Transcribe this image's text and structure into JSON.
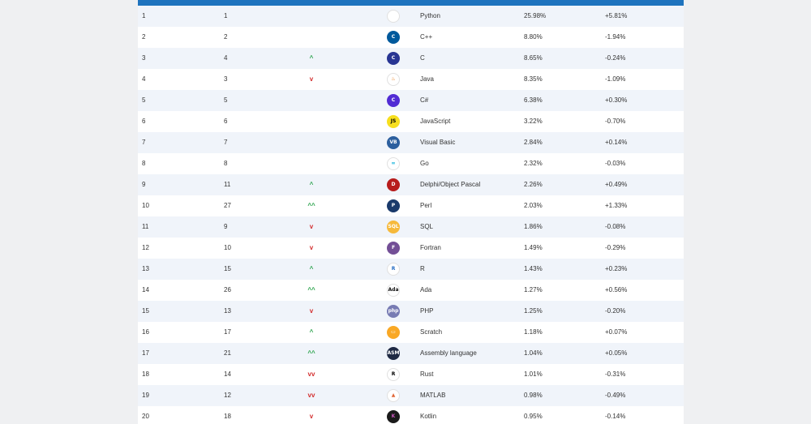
{
  "rows": [
    {
      "rank": "1",
      "prev": "1",
      "change": "",
      "icon": "python-icon",
      "glyph": "",
      "icon_bg": "#ffffff",
      "icon_fg": "#3776ab",
      "lang": "Python",
      "rating": "25.98%",
      "delta": "+5.81%"
    },
    {
      "rank": "2",
      "prev": "2",
      "change": "",
      "icon": "cpp-icon",
      "glyph": "C",
      "icon_bg": "#00599c",
      "icon_fg": "#ffffff",
      "lang": "C++",
      "rating": "8.80%",
      "delta": "-1.94%"
    },
    {
      "rank": "3",
      "prev": "4",
      "change": "up",
      "icon": "c-icon",
      "glyph": "C",
      "icon_bg": "#283593",
      "icon_fg": "#ffffff",
      "lang": "C",
      "rating": "8.65%",
      "delta": "-0.24%"
    },
    {
      "rank": "4",
      "prev": "3",
      "change": "down",
      "icon": "java-icon",
      "glyph": "♨",
      "icon_bg": "#ffffff",
      "icon_fg": "#e76f00",
      "lang": "Java",
      "rating": "8.35%",
      "delta": "-1.09%"
    },
    {
      "rank": "5",
      "prev": "5",
      "change": "",
      "icon": "csharp-icon",
      "glyph": "C",
      "icon_bg": "#512bd4",
      "icon_fg": "#ffffff",
      "lang": "C#",
      "rating": "6.38%",
      "delta": "+0.30%"
    },
    {
      "rank": "6",
      "prev": "6",
      "change": "",
      "icon": "javascript-icon",
      "glyph": "JS",
      "icon_bg": "#f7df1e",
      "icon_fg": "#000000",
      "lang": "JavaScript",
      "rating": "3.22%",
      "delta": "-0.70%"
    },
    {
      "rank": "7",
      "prev": "7",
      "change": "",
      "icon": "visual-basic-icon",
      "glyph": "VB",
      "icon_bg": "#2c5f9e",
      "icon_fg": "#ffffff",
      "lang": "Visual Basic",
      "rating": "2.84%",
      "delta": "+0.14%"
    },
    {
      "rank": "8",
      "prev": "8",
      "change": "",
      "icon": "go-icon",
      "glyph": "∞",
      "icon_bg": "#ffffff",
      "icon_fg": "#00add8",
      "lang": "Go",
      "rating": "2.32%",
      "delta": "-0.03%"
    },
    {
      "rank": "9",
      "prev": "11",
      "change": "up",
      "icon": "delphi-icon",
      "glyph": "D",
      "icon_bg": "#b71c1c",
      "icon_fg": "#ffffff",
      "lang": "Delphi/Object Pascal",
      "rating": "2.26%",
      "delta": "+0.49%"
    },
    {
      "rank": "10",
      "prev": "27",
      "change": "up2",
      "icon": "perl-icon",
      "glyph": "P",
      "icon_bg": "#1a3a6b",
      "icon_fg": "#ffffff",
      "lang": "Perl",
      "rating": "2.03%",
      "delta": "+1.33%"
    },
    {
      "rank": "11",
      "prev": "9",
      "change": "down",
      "icon": "sql-icon",
      "glyph": "SQL",
      "icon_bg": "#f6b93b",
      "icon_fg": "#ffffff",
      "lang": "SQL",
      "rating": "1.86%",
      "delta": "-0.08%"
    },
    {
      "rank": "12",
      "prev": "10",
      "change": "down",
      "icon": "fortran-icon",
      "glyph": "F",
      "icon_bg": "#734f96",
      "icon_fg": "#ffffff",
      "lang": "Fortran",
      "rating": "1.49%",
      "delta": "-0.29%"
    },
    {
      "rank": "13",
      "prev": "15",
      "change": "up",
      "icon": "r-icon",
      "glyph": "R",
      "icon_bg": "#ffffff",
      "icon_fg": "#276dc3",
      "lang": "R",
      "rating": "1.43%",
      "delta": "+0.23%"
    },
    {
      "rank": "14",
      "prev": "26",
      "change": "up2",
      "icon": "ada-icon",
      "glyph": "Ada",
      "icon_bg": "#ffffff",
      "icon_fg": "#111111",
      "lang": "Ada",
      "rating": "1.27%",
      "delta": "+0.56%"
    },
    {
      "rank": "15",
      "prev": "13",
      "change": "down",
      "icon": "php-icon",
      "glyph": "php",
      "icon_bg": "#777bb3",
      "icon_fg": "#ffffff",
      "lang": "PHP",
      "rating": "1.25%",
      "delta": "-0.20%"
    },
    {
      "rank": "16",
      "prev": "17",
      "change": "up",
      "icon": "scratch-icon",
      "glyph": "▭",
      "icon_bg": "#f9a825",
      "icon_fg": "#ffffff",
      "lang": "Scratch",
      "rating": "1.18%",
      "delta": "+0.07%"
    },
    {
      "rank": "17",
      "prev": "21",
      "change": "up2",
      "icon": "assembly-icon",
      "glyph": "ASM",
      "icon_bg": "#1f2a44",
      "icon_fg": "#ffffff",
      "lang": "Assembly language",
      "rating": "1.04%",
      "delta": "+0.05%"
    },
    {
      "rank": "18",
      "prev": "14",
      "change": "down2",
      "icon": "rust-icon",
      "glyph": "R",
      "icon_bg": "#ffffff",
      "icon_fg": "#000000",
      "lang": "Rust",
      "rating": "1.01%",
      "delta": "-0.31%"
    },
    {
      "rank": "19",
      "prev": "12",
      "change": "down2",
      "icon": "matlab-icon",
      "glyph": "▲",
      "icon_bg": "#ffffff",
      "icon_fg": "#e16737",
      "lang": "MATLAB",
      "rating": "0.98%",
      "delta": "-0.49%"
    },
    {
      "rank": "20",
      "prev": "18",
      "change": "down",
      "icon": "kotlin-icon",
      "glyph": "K",
      "icon_bg": "#1a1a1a",
      "icon_fg": "#c757bc",
      "lang": "Kotlin",
      "rating": "0.95%",
      "delta": "-0.14%"
    }
  ],
  "arrows": {
    "up": "^",
    "up2": "^^",
    "down": "v",
    "down2": "vv"
  },
  "colors": {
    "header": "#1e73be",
    "row_alt": "#f0f4fa",
    "up": "#2ea44f",
    "down": "#d32f2f"
  }
}
